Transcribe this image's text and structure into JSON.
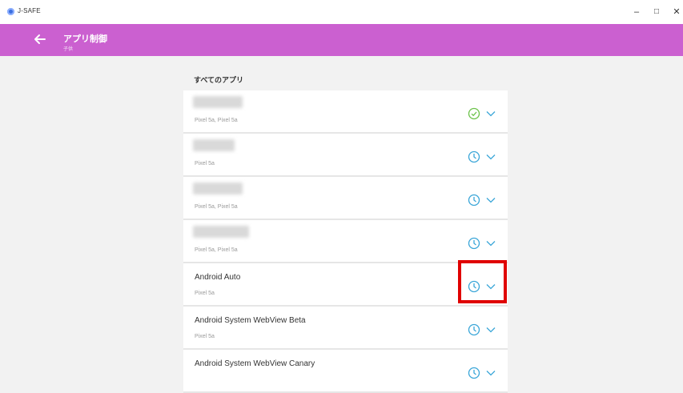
{
  "window": {
    "title": "J-SAFE",
    "minimize": "–",
    "maximize": "□",
    "close": "✕"
  },
  "header": {
    "title": "アプリ制御",
    "subtitle": "子供"
  },
  "section": {
    "heading": "すべてのアプリ"
  },
  "apps": [
    {
      "name": "",
      "devices": "Pixel 5a, Pixel 5a",
      "status": "allowed"
    },
    {
      "name": "",
      "devices": "Pixel 5a",
      "status": "time-limited"
    },
    {
      "name": "",
      "devices": "Pixel 5a, Pixel 5a",
      "status": "time-limited"
    },
    {
      "name": "",
      "devices": "Pixel 5a, Pixel 5a",
      "status": "time-limited"
    },
    {
      "name": "Android Auto",
      "devices": "Pixel 5a",
      "status": "time-limited"
    },
    {
      "name": "Android System WebView Beta",
      "devices": "Pixel 5a",
      "status": "time-limited"
    },
    {
      "name": "Android System WebView Canary",
      "devices": "",
      "status": "time-limited"
    }
  ],
  "colors": {
    "header_bg": "#cb60d0",
    "icon_green": "#6cc24a",
    "icon_teal": "#3aa6d8",
    "highlight": "#e00000"
  }
}
